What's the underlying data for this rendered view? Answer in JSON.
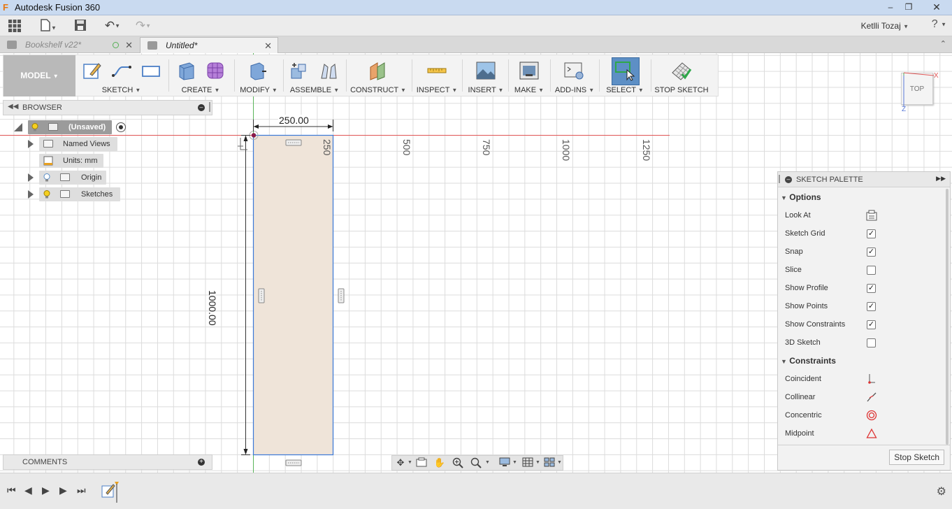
{
  "window": {
    "title": "Autodesk Fusion 360",
    "app_icon": "F",
    "controls": [
      "minimize",
      "maximize",
      "close"
    ]
  },
  "quick_access": {
    "user_name": "Ketlli Tozaj",
    "help": "?",
    "icons": [
      "apps-grid-icon",
      "file-icon",
      "save-icon",
      "undo-icon",
      "redo-icon"
    ]
  },
  "tabs": [
    {
      "label": "Bookshelf v22*",
      "active": false
    },
    {
      "label": "Untitled*",
      "active": true
    }
  ],
  "toolbar": {
    "workspace": "MODEL",
    "groups": [
      {
        "label": "SKETCH"
      },
      {
        "label": "CREATE"
      },
      {
        "label": "MODIFY"
      },
      {
        "label": "ASSEMBLE"
      },
      {
        "label": "CONSTRUCT"
      },
      {
        "label": "INSPECT"
      },
      {
        "label": "INSERT"
      },
      {
        "label": "MAKE"
      },
      {
        "label": "ADD-INS"
      },
      {
        "label": "SELECT"
      },
      {
        "label": "STOP SKETCH"
      }
    ]
  },
  "browser": {
    "title": "BROWSER",
    "root": "(Unsaved)",
    "items": [
      {
        "label": "Named Views"
      },
      {
        "label": "Units: mm"
      },
      {
        "label": "Origin"
      },
      {
        "label": "Sketches"
      }
    ]
  },
  "comments": {
    "title": "COMMENTS"
  },
  "sketch": {
    "width_dimension": "250.00",
    "height_dimension": "1000.00",
    "ruler_ticks": [
      "250",
      "500",
      "750",
      "1000",
      "1250"
    ],
    "colors": {
      "profile_fill": "#efe4d9",
      "profile_stroke": "#3a78d8",
      "x_axis": "#e05555",
      "y_axis": "#5ab55a"
    }
  },
  "view_cube": {
    "face": "TOP",
    "x_axis": "X",
    "z_axis": "Z"
  },
  "palette": {
    "title": "SKETCH PALETTE",
    "options_title": "Options",
    "options": [
      {
        "label": "Look At",
        "type": "icon"
      },
      {
        "label": "Sketch Grid",
        "checked": true
      },
      {
        "label": "Snap",
        "checked": true
      },
      {
        "label": "Slice",
        "checked": false
      },
      {
        "label": "Show Profile",
        "checked": true
      },
      {
        "label": "Show Points",
        "checked": true
      },
      {
        "label": "Show Constraints",
        "checked": true
      },
      {
        "label": "3D Sketch",
        "checked": false
      }
    ],
    "constraints_title": "Constraints",
    "constraints": [
      {
        "label": "Coincident",
        "icon": "coincident-icon"
      },
      {
        "label": "Collinear",
        "icon": "collinear-icon"
      },
      {
        "label": "Concentric",
        "icon": "concentric-icon"
      },
      {
        "label": "Midpoint",
        "icon": "midpoint-icon"
      }
    ],
    "stop_button": "Stop Sketch"
  }
}
